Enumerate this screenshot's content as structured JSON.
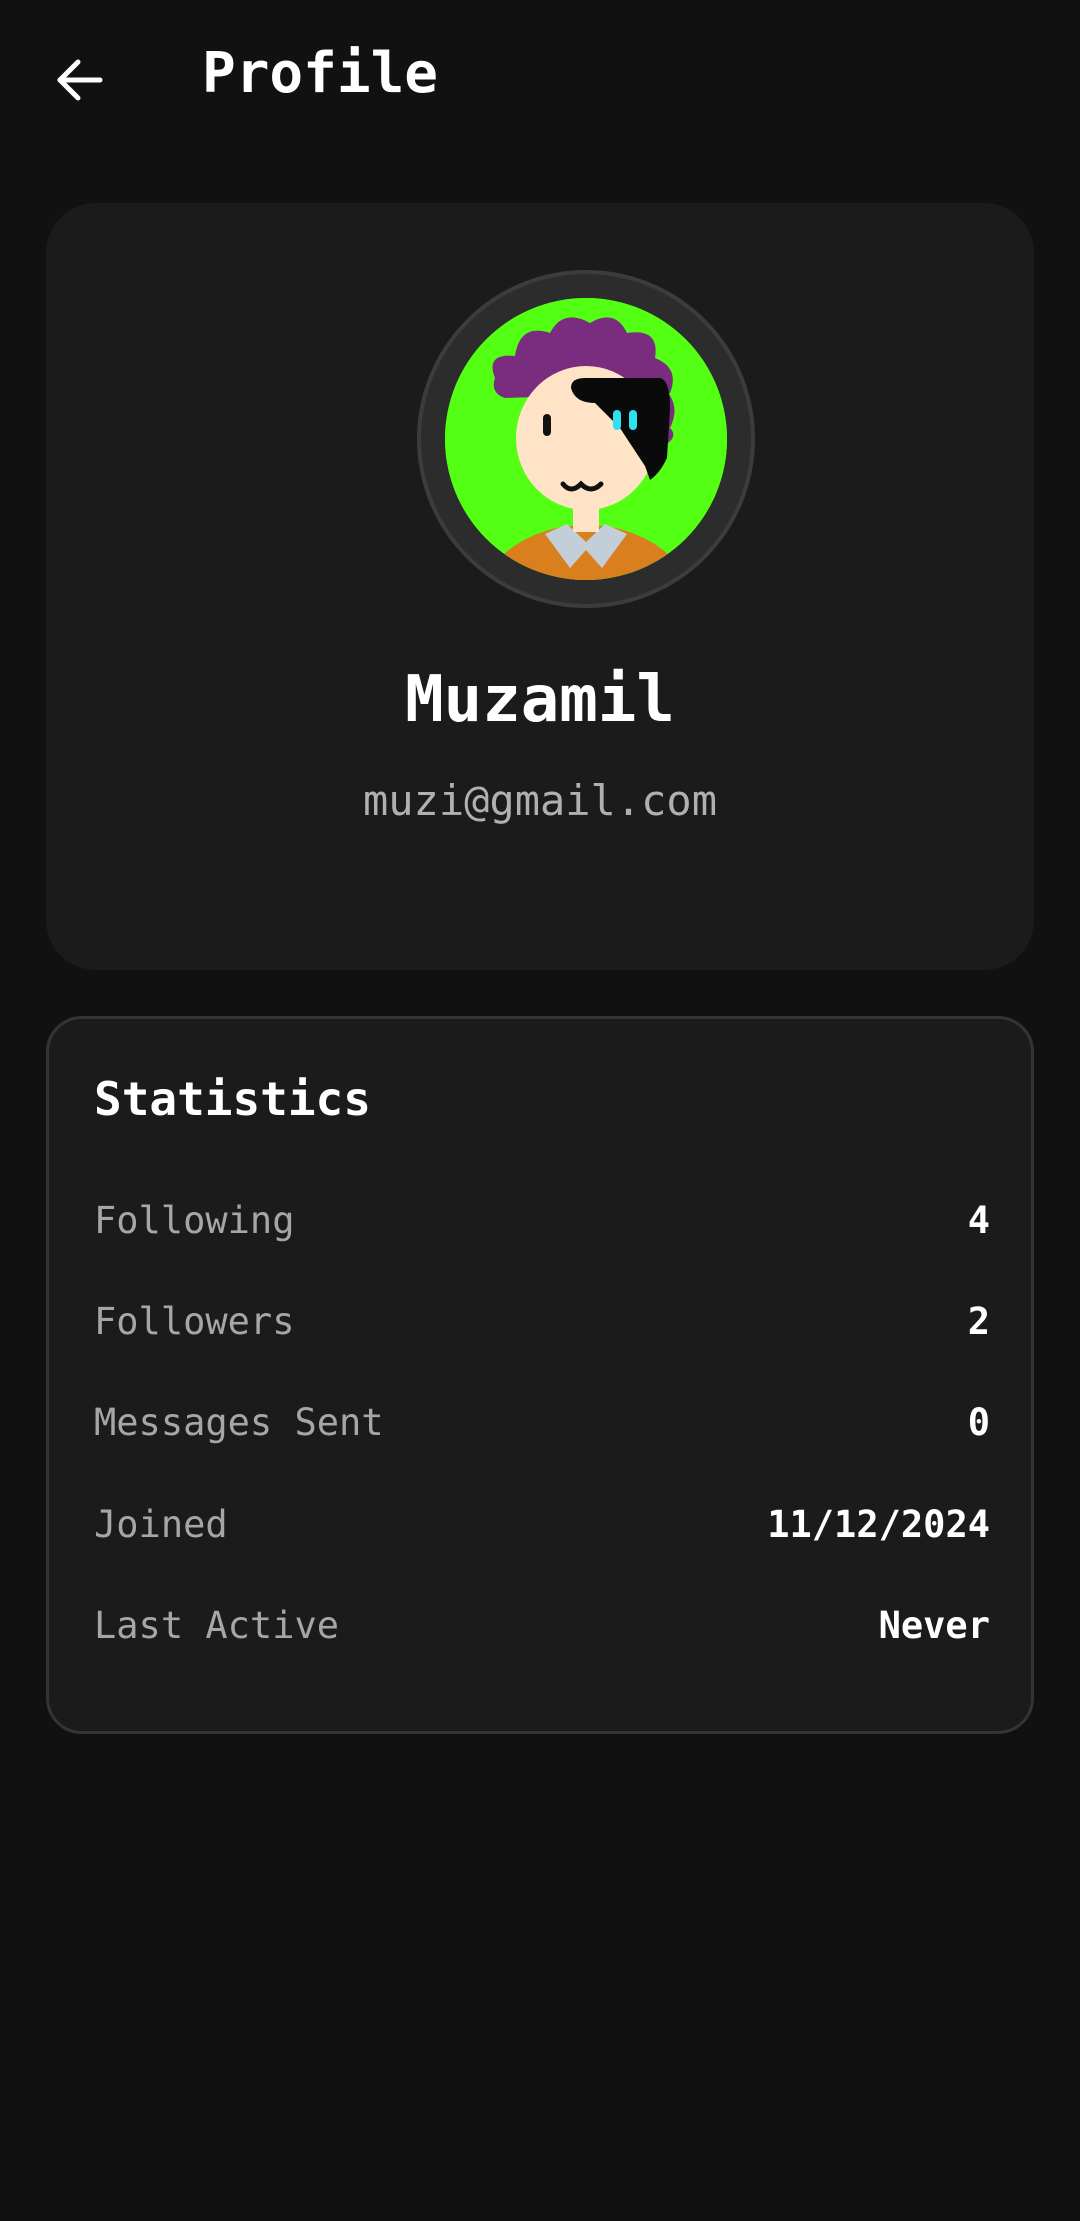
{
  "header": {
    "title": "Profile",
    "back_icon": "arrow-left-icon"
  },
  "profile": {
    "name": "Muzamil",
    "email": "muzi@gmail.com",
    "avatar_icon": "cartoon-avatar-icon",
    "avatar_bg": "#53ff12"
  },
  "statistics": {
    "title": "Statistics",
    "rows": [
      {
        "label": "Following",
        "value": "4"
      },
      {
        "label": "Followers",
        "value": "2"
      },
      {
        "label": "Messages Sent",
        "value": "0"
      },
      {
        "label": "Joined",
        "value": "11/12/2024"
      },
      {
        "label": "Last Active",
        "value": "Never"
      }
    ]
  }
}
